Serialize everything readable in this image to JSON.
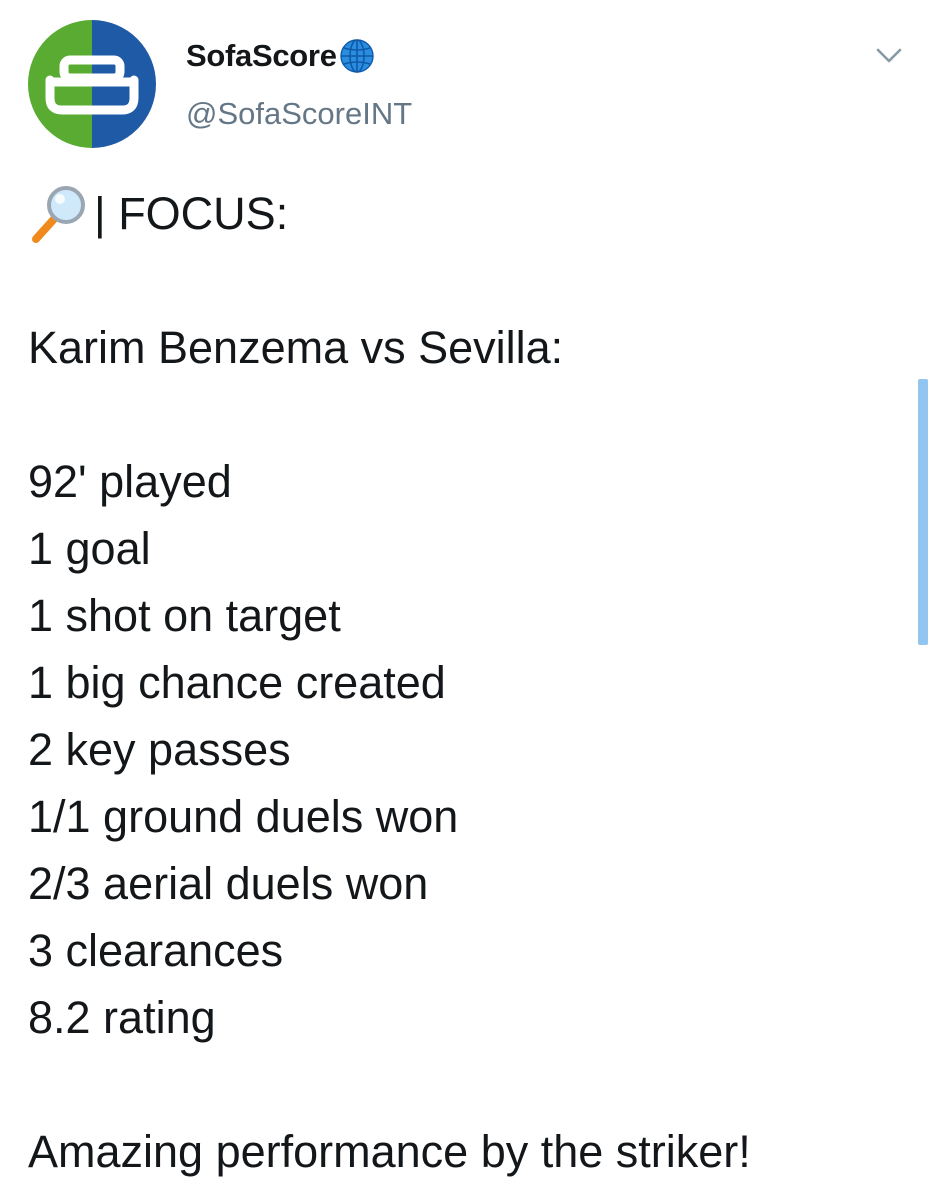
{
  "author": {
    "display_name": "SofaScore",
    "handle": "@SofaScoreINT",
    "avatar_icon": "sofascore-logo-icon",
    "badge_icon": "globe-icon",
    "brand_colors": {
      "green": "#5aab32",
      "blue": "#1f5aa6"
    }
  },
  "tweet": {
    "focus_label": "| FOCUS:",
    "focus_icon": "magnifying-glass-icon",
    "headline": "Karim Benzema vs Sevilla:",
    "stats": [
      "92' played",
      "1 goal",
      "1 shot on target",
      "1 big chance created",
      "2 key passes",
      "1/1 ground duels won",
      "2/3 aerial duels won",
      "3 clearances",
      "8.2 rating"
    ],
    "closing": "Amazing performance by the striker!"
  },
  "menu_icon": "chevron-down-icon"
}
